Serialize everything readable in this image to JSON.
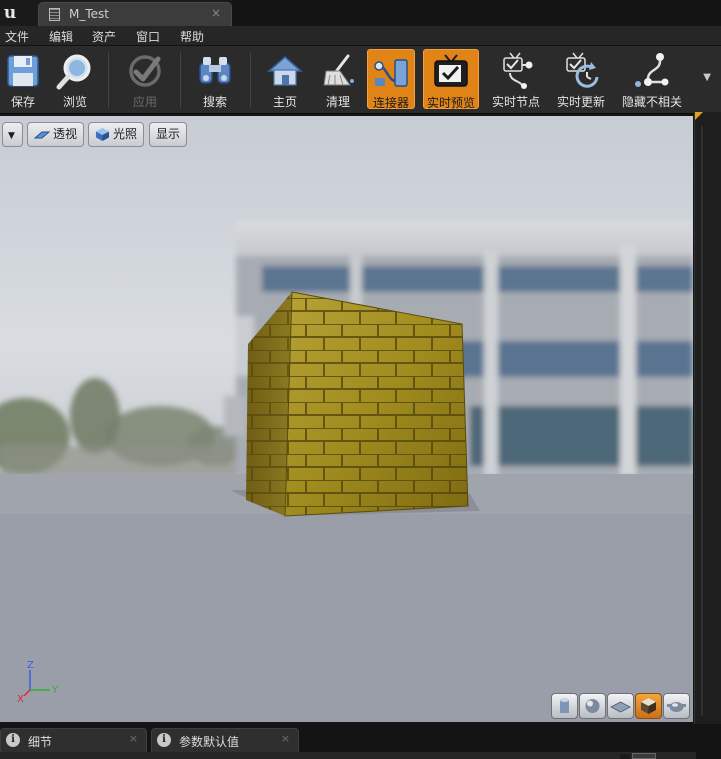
{
  "tab": {
    "title": "M_Test",
    "close": "×"
  },
  "menu": {
    "items": [
      "文件",
      "编辑",
      "资产",
      "窗口",
      "帮助"
    ]
  },
  "toolbar": {
    "save": "保存",
    "browse": "浏览",
    "apply": "应用",
    "search": "搜索",
    "home": "主页",
    "clean": "清理",
    "connectors": "连接器",
    "live_preview": "实时预览",
    "live_nodes": "实时节点",
    "live_update": "实时更新",
    "hide_unrelated": "隐藏不相关",
    "active_buttons": [
      "连接器",
      "实时预览"
    ],
    "disabled_buttons": [
      "应用"
    ],
    "accent_color": "#e08418"
  },
  "viewport": {
    "perspective": "透视",
    "lit": "光照",
    "show": "显示",
    "axis": {
      "z": "Z",
      "x": "X",
      "y": "Y"
    },
    "active_view_mode": "cube"
  },
  "bottom_tabs": [
    {
      "label": "细节",
      "close": "×"
    },
    {
      "label": "参数默认值",
      "close": "×"
    }
  ]
}
